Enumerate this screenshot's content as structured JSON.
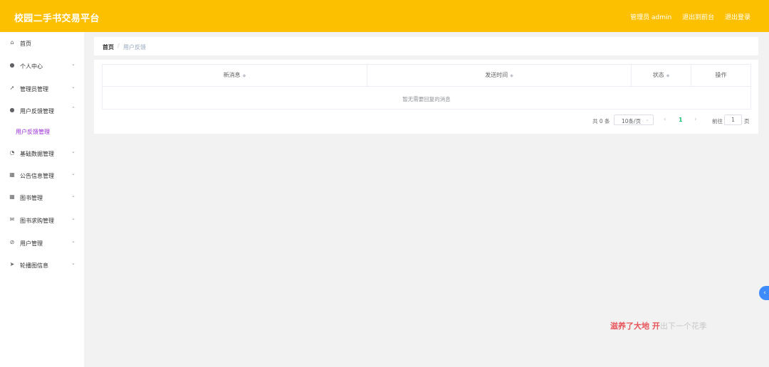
{
  "header": {
    "title": "校园二手书交易平台",
    "admin_label": "管理员 admin",
    "to_front_label": "退出到前台",
    "logout_label": "退出登录"
  },
  "sidebar": {
    "items": [
      {
        "label": "首页",
        "icon": "home-icon",
        "glyph": "⌂",
        "chevron": ""
      },
      {
        "label": "个人中心",
        "icon": "user-icon",
        "glyph": "●",
        "chevron": "⌄"
      },
      {
        "label": "管理员管理",
        "icon": "send-icon",
        "glyph": "➚",
        "chevron": "⌄"
      },
      {
        "label": "用户反馈管理",
        "icon": "user-icon",
        "glyph": "●",
        "chevron": "⌃"
      },
      {
        "label": "基础数据管理",
        "icon": "dashboard-icon",
        "glyph": "◔",
        "chevron": "⌄"
      },
      {
        "label": "公告信息管理",
        "icon": "chart-icon",
        "glyph": "▦",
        "chevron": "⌄"
      },
      {
        "label": "图书管理",
        "icon": "grid-icon",
        "glyph": "▦",
        "chevron": "⌄"
      },
      {
        "label": "图书求购管理",
        "icon": "mail-icon",
        "glyph": "✉",
        "chevron": "⌄"
      },
      {
        "label": "用户管理",
        "icon": "bell-off-icon",
        "glyph": "⊘",
        "chevron": "⌄"
      },
      {
        "label": "轮播图信息",
        "icon": "plane-icon",
        "glyph": "➤",
        "chevron": "⌄"
      }
    ],
    "active_submenu": "用户反馈管理"
  },
  "breadcrumb": {
    "home": "首页",
    "separator": "/",
    "current": "用户反馈"
  },
  "table": {
    "columns": [
      {
        "label": "新消息",
        "sortable": true
      },
      {
        "label": "发送时间",
        "sortable": true
      },
      {
        "label": "状态",
        "sortable": true
      },
      {
        "label": "操作",
        "sortable": false
      }
    ],
    "empty_text": "暂无需要回复的消息"
  },
  "pagination": {
    "total_text": "共 0 条",
    "page_size": "10条/页",
    "current_page": "1",
    "goto_label": "前往",
    "goto_value": "1",
    "page_unit": "页"
  },
  "watermark": {
    "part1": "滋养了大地 开",
    "part2": "出下一个花季"
  },
  "colors": {
    "header_bg": "#fdc000",
    "active_submenu": "#9b2cd6",
    "active_page": "#19be6b",
    "collapse_button": "#3d8bfd"
  }
}
